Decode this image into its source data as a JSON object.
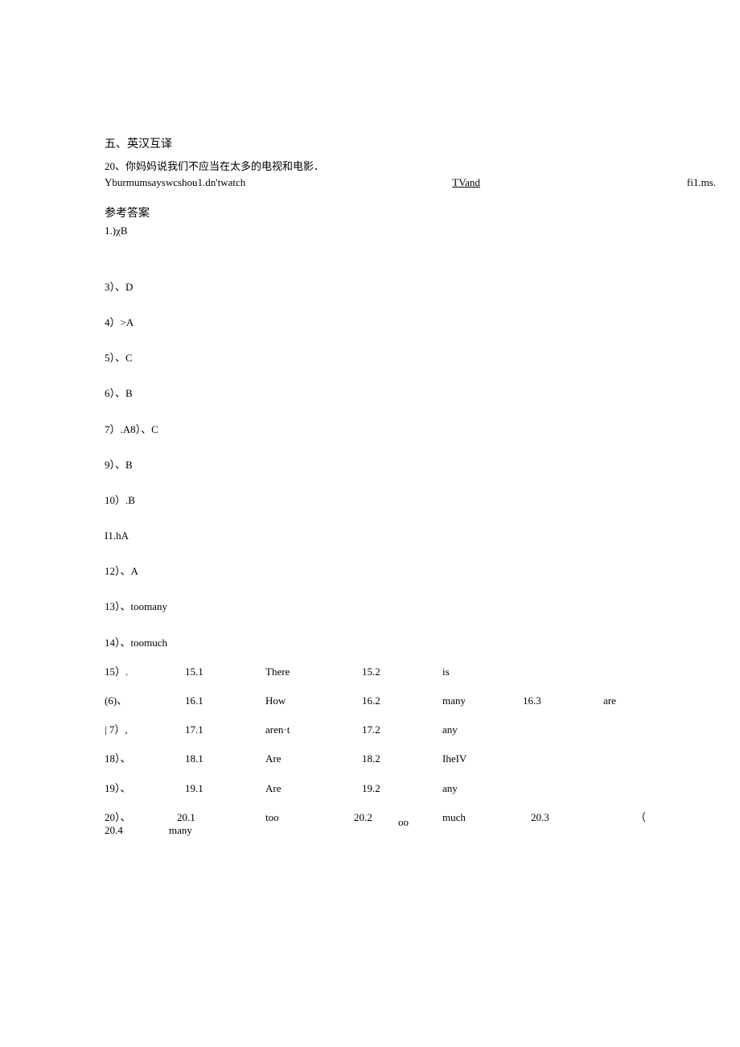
{
  "section5": {
    "title": "五、英汉互译",
    "q20_prompt": "20、你妈妈说我们不应当在太多的电视和电影．",
    "q20_sentence_part1": "Yburmumsayswcshou1.dn'twatch",
    "q20_blank1_label": "TVand",
    "q20_blank2_label": "fi1.ms."
  },
  "answers_title": "参考答案",
  "answers_simple": [
    "1.)χB",
    "3）、D",
    "4）>A",
    "5）、C",
    "6）、B",
    "7）.A8）、C",
    "9）、B",
    "10）.B",
    "I1.hA",
    "12）、A",
    "13）、toomany",
    "14）、toomuch"
  ],
  "answers_table": [
    {
      "c1": "15）.",
      "c2": "15.1",
      "c3": "There",
      "c4": "15.2",
      "c5": "is",
      "c6": "",
      "c7": ""
    },
    {
      "c1": "(6)、",
      "c2": "16.1",
      "c3": "How",
      "c4": "16.2",
      "c5": "many",
      "c6": "16.3",
      "c7": "are"
    },
    {
      "c1": "| 7）,",
      "c2": "17.1",
      "c3": "aren·t",
      "c4": "17.2",
      "c5": "any",
      "c6": "",
      "c7": ""
    },
    {
      "c1": "18）、",
      "c2": "18.1",
      "c3": "Are",
      "c4": "18.2",
      "c5": "IheIV",
      "c6": "",
      "c7": ""
    },
    {
      "c1": "19）、",
      "c2": "19.1",
      "c3": "Are",
      "c4": "19.2",
      "c5": "any",
      "c6": "",
      "c7": ""
    }
  ],
  "answer20": {
    "r1": {
      "a": "20）、",
      "b": "20.1",
      "c": "too",
      "d": "20.2",
      "e": "οο",
      "f": "much",
      "g": "20.3",
      "h": "（"
    },
    "r2": {
      "a": "20.4",
      "b": "many"
    }
  }
}
